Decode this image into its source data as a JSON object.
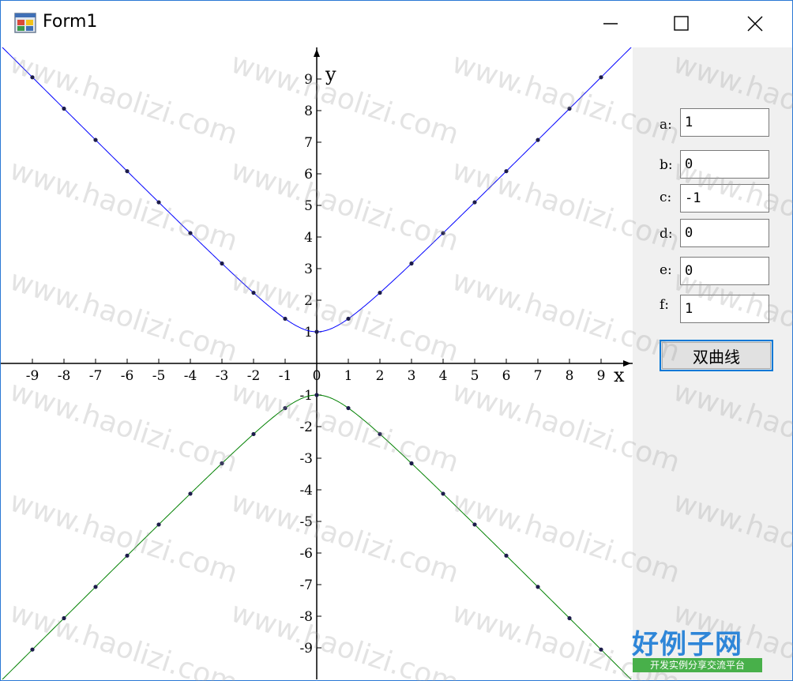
{
  "window": {
    "title": "Form1",
    "controls": {
      "minimize": "minimize",
      "maximize": "maximize",
      "close": "close"
    }
  },
  "params": [
    {
      "label": "a:",
      "value": "1"
    },
    {
      "label": "b:",
      "value": "0"
    },
    {
      "label": "c:",
      "value": "-1"
    },
    {
      "label": "d:",
      "value": "0"
    },
    {
      "label": "e:",
      "value": "0"
    },
    {
      "label": "f:",
      "value": "1"
    }
  ],
  "action_button": {
    "label": "双曲线"
  },
  "watermark": {
    "text": "www.haolizi.com"
  },
  "logo": {
    "main": "好例子网",
    "sub": "开发实例分享交流平台"
  },
  "chart_data": {
    "type": "line",
    "xlabel": "x",
    "ylabel": "y",
    "xlim": [
      -10,
      10
    ],
    "ylim": [
      -10,
      10
    ],
    "x_ticks": [
      -9,
      -8,
      -7,
      -6,
      -5,
      -4,
      -3,
      -2,
      -1,
      0,
      1,
      2,
      3,
      4,
      5,
      6,
      7,
      8,
      9
    ],
    "y_ticks": [
      -9,
      -8,
      -7,
      -6,
      -5,
      -4,
      -3,
      -2,
      -1,
      1,
      2,
      3,
      4,
      5,
      6,
      7,
      8,
      9
    ],
    "colors": {
      "upper": "#0000ff",
      "lower": "#008000",
      "axis": "#000000"
    },
    "series": [
      {
        "color": "#0000ff",
        "x": [
          -9,
          -8,
          -7,
          -6,
          -5,
          -4,
          -3,
          -2,
          -1,
          0,
          1,
          2,
          3,
          4,
          5,
          6,
          7,
          8,
          9
        ],
        "y": [
          9.055,
          8.062,
          7.071,
          6.083,
          5.099,
          4.123,
          3.162,
          2.236,
          1.414,
          1,
          1.414,
          2.236,
          3.162,
          4.123,
          5.099,
          6.083,
          7.071,
          8.062,
          9.055
        ]
      },
      {
        "color": "#008000",
        "x": [
          -9,
          -8,
          -7,
          -6,
          -5,
          -4,
          -3,
          -2,
          -1,
          0,
          1,
          2,
          3,
          4,
          5,
          6,
          7,
          8,
          9
        ],
        "y": [
          -9.055,
          -8.062,
          -7.071,
          -6.083,
          -5.099,
          -4.123,
          -3.162,
          -2.236,
          -1.414,
          -1,
          -1.414,
          -2.236,
          -3.162,
          -4.123,
          -5.099,
          -6.083,
          -7.071,
          -8.062,
          -9.055
        ]
      }
    ]
  }
}
